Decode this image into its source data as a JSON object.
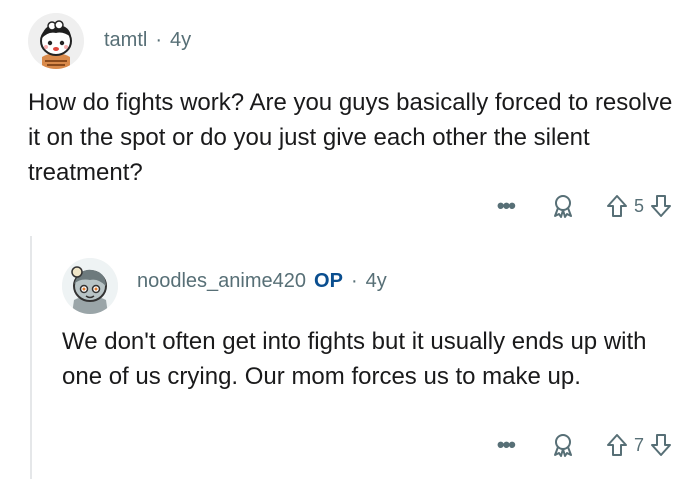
{
  "comments": [
    {
      "username": "tamtl",
      "separator": "·",
      "age": "4y",
      "body": "How do fights work? Are you guys basically forced to resolve it on the spot or do you just give each other the silent treatment?",
      "more_label": "•••",
      "votes": "5"
    },
    {
      "username": "noodles_anime420",
      "op_badge": "OP",
      "separator": "·",
      "age": "4y",
      "body": "We don't often get into fights but it usually ends up with one of us crying. Our mom forces us to make up.",
      "more_label": "•••",
      "votes": "7"
    }
  ],
  "icons": {
    "more": "more-options-icon",
    "award": "award-icon",
    "upvote": "upvote-arrow-icon",
    "downvote": "downvote-arrow-icon"
  },
  "colors": {
    "meta_text": "#576f76",
    "op_badge": "#0a4e8f",
    "body_text": "#1a1a1b",
    "thread_line": "#e5e7e9"
  }
}
